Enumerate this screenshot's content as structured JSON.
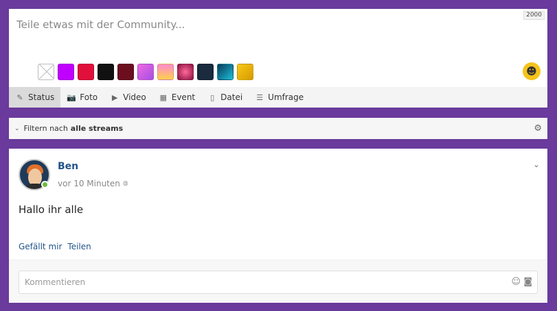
{
  "composer": {
    "placeholder": "Teile etwas mit der Community...",
    "char_counter": "2000",
    "swatches": [
      {
        "name": "none",
        "color": "#ffffff"
      },
      {
        "name": "violet",
        "color": "#c000ff"
      },
      {
        "name": "crimson",
        "color": "#e0103a"
      },
      {
        "name": "black",
        "color": "#111111"
      },
      {
        "name": "maroon",
        "color": "#6b0f1f"
      },
      {
        "name": "pink-purple-gradient",
        "color": "linear-gradient(135deg,#f06adf,#a44fe6)"
      },
      {
        "name": "pink-yellow-gradient",
        "color": "linear-gradient(180deg,#ff8ad0,#ffd04a)"
      },
      {
        "name": "pink-pattern",
        "color": "radial-gradient(circle,#ff6a9a,#8a1040)"
      },
      {
        "name": "navy",
        "color": "#1a2a3f"
      },
      {
        "name": "teal-gradient",
        "color": "linear-gradient(135deg,#0a3a5a,#1ac0d8)"
      },
      {
        "name": "gold-gradient",
        "color": "linear-gradient(135deg,#f6c818,#d89a00)"
      }
    ],
    "emoji_icon": "smiley-icon"
  },
  "tabs": [
    {
      "label": "Status",
      "icon": "pencil-icon",
      "glyph": "✎",
      "active": true
    },
    {
      "label": "Foto",
      "icon": "camera-icon",
      "glyph": "📷",
      "active": false
    },
    {
      "label": "Video",
      "icon": "video-icon",
      "glyph": "▶",
      "active": false
    },
    {
      "label": "Event",
      "icon": "calendar-icon",
      "glyph": "▦",
      "active": false
    },
    {
      "label": "Datei",
      "icon": "file-icon",
      "glyph": "▯",
      "active": false
    },
    {
      "label": "Umfrage",
      "icon": "list-icon",
      "glyph": "☰",
      "active": false
    }
  ],
  "filter": {
    "prefix": "Filtern nach",
    "value": "alle streams"
  },
  "post": {
    "author": "Ben",
    "time": "vor 10 Minuten",
    "content": "Hallo ihr alle",
    "like_label": "Gefällt mir",
    "share_label": "Teilen",
    "comment_placeholder": "Kommentieren"
  },
  "colors": {
    "background": "#6a3a9c",
    "link": "#21548a",
    "online": "#6dbd3f"
  }
}
